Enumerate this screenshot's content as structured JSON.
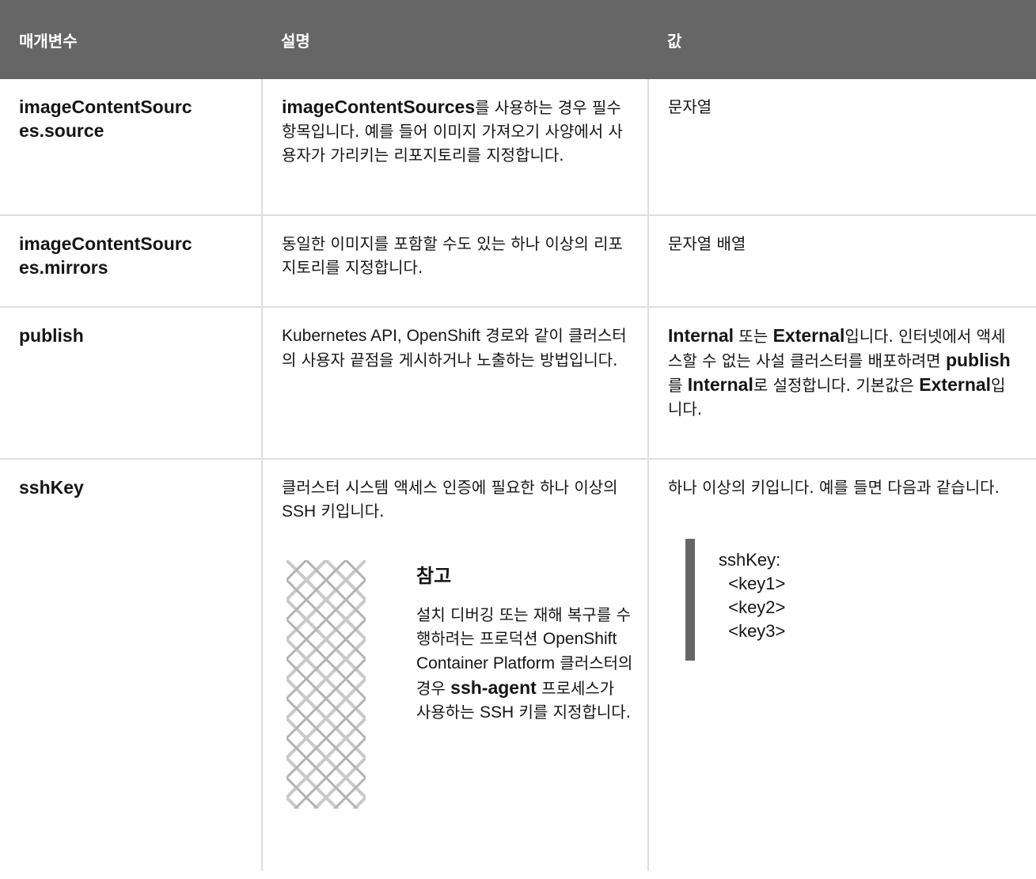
{
  "table": {
    "headers": [
      "매개변수",
      "설명",
      "값"
    ],
    "rows": [
      {
        "parameter_line1": "imageContentSourc",
        "parameter_line2": "es.source",
        "description_bold": "imageContentSources",
        "description_text": "를 사용하는 경우 필수 항목입니다. 예를 들어 이미지 가져오기 사양에서 사용자가 가리키는 리포지토리를 지정합니다.",
        "value": "문자열"
      },
      {
        "parameter_line1": "imageContentSourc",
        "parameter_line2": "es.mirrors",
        "description": "동일한 이미지를 포함할 수도 있는 하나 이상의 리포지토리를 지정합니다.",
        "value": "문자열 배열"
      },
      {
        "parameter": "publish",
        "description_latin": "Kubernetes API, OpenShift",
        "description_text": " 경로와 같이 클러스터의 사용자 끝점을 게시하거나 노출하는 방법입니다.",
        "value_parts": {
          "internal": "Internal",
          "or": " 또는 ",
          "external": "External",
          "text1": "입니다. 인터넷에서 액세스할 수 없는 사설 클러스터를 배포하려면 ",
          "publish": "publish",
          "text2": "를 ",
          "internal2": "Internal",
          "text3": "로 설정합니다. 기본값은 ",
          "external2": "External",
          "text4": "입니다."
        }
      },
      {
        "parameter": "sshKey",
        "description_text1": "클러스터 시스템 액세스 인증에 필요한 하나 이상의 ",
        "description_ssh": "SSH",
        "description_text2": " 키입니다.",
        "note": {
          "title": "참고",
          "text1": "설치 디버깅 또는 재해 복구를 수행하려는 프로덕션 ",
          "latin1": "OpenShift Container Platform",
          "text2": " 클러스터의 경우 ",
          "bold": "ssh-agent",
          "text3": " 프로세스가 사용하는 ",
          "latin2": "SSH",
          "text4": " 키를 지정합니다."
        },
        "value_text": "하나 이상의 키입니다. 예를 들면 다음과 같습니다.",
        "code_lines": [
          "sshKey:",
          "  <key1>",
          "  <key2>",
          "  <key3>"
        ]
      }
    ]
  },
  "colors": {
    "header_bg": "#666666",
    "border": "#dedede",
    "code_bar": "#666666"
  }
}
